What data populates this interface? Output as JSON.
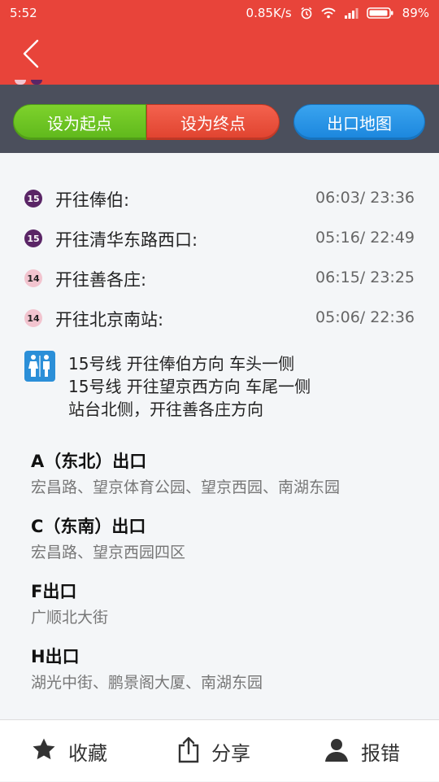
{
  "status_bar": {
    "time": "5:52",
    "speed": "0.85K/s",
    "battery": "89%",
    "icons": [
      "alarm-icon",
      "wifi-icon",
      "signal-icon",
      "battery-icon"
    ]
  },
  "header": {
    "back_icon": "chevron-left-icon",
    "color": "#e8443a"
  },
  "actions": {
    "set_start": "设为起点",
    "set_end": "设为终点",
    "exit_map": "出口地图",
    "colors": {
      "start": "#6cc524",
      "end": "#ea4e3a",
      "map": "#2a95e5"
    }
  },
  "schedule": [
    {
      "line": "15",
      "direction": "开往俸伯:",
      "times": "06:03/ 23:36",
      "color": "#5a2566"
    },
    {
      "line": "15",
      "direction": "开往清华东路西口:",
      "times": "05:16/ 22:49",
      "color": "#5a2566"
    },
    {
      "line": "14",
      "direction": "开往善各庄:",
      "times": "06:15/ 23:25",
      "color": "#f2c4cf"
    },
    {
      "line": "14",
      "direction": "开往北京南站:",
      "times": "05:06/ 22:36",
      "color": "#f2c4cf"
    }
  ],
  "toilet": {
    "icon": "toilet-icon",
    "lines": [
      "15号线 开往俸伯方向 车头一侧",
      "15号线 开往望京西方向 车尾一侧",
      "站台北侧，开往善各庄方向"
    ]
  },
  "exits": [
    {
      "name": "A（东北）出口",
      "streets": "宏昌路、望京体育公园、望京西园、南湖东园"
    },
    {
      "name": "C（东南）出口",
      "streets": "宏昌路、望京西园四区"
    },
    {
      "name": "F出口",
      "streets": "广顺北大街"
    },
    {
      "name": "H出口",
      "streets": "湖光中街、鹏景阁大厦、南湖东园"
    }
  ],
  "bottom_bar": {
    "favorite": "收藏",
    "share": "分享",
    "report": "报错"
  }
}
